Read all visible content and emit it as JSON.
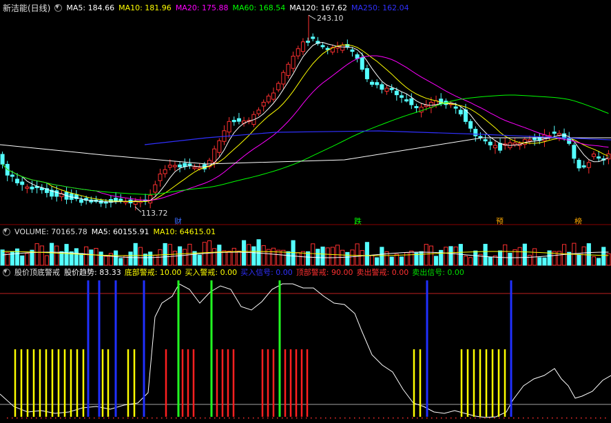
{
  "header": {
    "stock": "新洁能(日线)",
    "ma": [
      {
        "text": "MA5: 184.66",
        "color": "#ffffff"
      },
      {
        "text": "MA10: 181.96",
        "color": "#ffff00"
      },
      {
        "text": "MA20: 175.88",
        "color": "#ff00ff"
      },
      {
        "text": "MA60: 168.54",
        "color": "#00ff00"
      },
      {
        "text": "MA120: 167.62",
        "color": "#ffffff"
      },
      {
        "text": "MA250: 162.04",
        "color": "#3030ff"
      }
    ]
  },
  "price": {
    "high_label": "243.10",
    "low_label": "113.72",
    "markers": [
      {
        "text": "财",
        "color": "#3a6bff"
      },
      {
        "text": "跌",
        "color": "#00ff00"
      },
      {
        "text": "预",
        "color": "#ffaa00"
      },
      {
        "text": "榜",
        "color": "#ffaa00"
      }
    ]
  },
  "volume": {
    "title": "VOLUME: 70165.78",
    "ma5": "MA5: 60155.91",
    "ma10": "MA10: 64615.01"
  },
  "indicator": {
    "name": "股价顶底警戒",
    "items": [
      {
        "text": "股价趋势: 83.33",
        "color": "#ffffff"
      },
      {
        "text": "底部警戒: 10.00",
        "color": "#ffff00"
      },
      {
        "text": "买入警戒: 0.00",
        "color": "#ffff00"
      },
      {
        "text": "买入信号: 0.00",
        "color": "#3030ff"
      },
      {
        "text": "顶部警戒: 90.00",
        "color": "#ff3030"
      },
      {
        "text": "卖出警戒: 0.00",
        "color": "#ff3030"
      },
      {
        "text": "卖出信号: 0.00",
        "color": "#00dd00"
      }
    ]
  },
  "colors": {
    "up": "#ff3030",
    "down": "#54ffff",
    "yellow": "#ffff00",
    "blue": "#2030ff",
    "green": "#22ff22",
    "red": "#ff2020",
    "white": "#ffffff"
  }
}
